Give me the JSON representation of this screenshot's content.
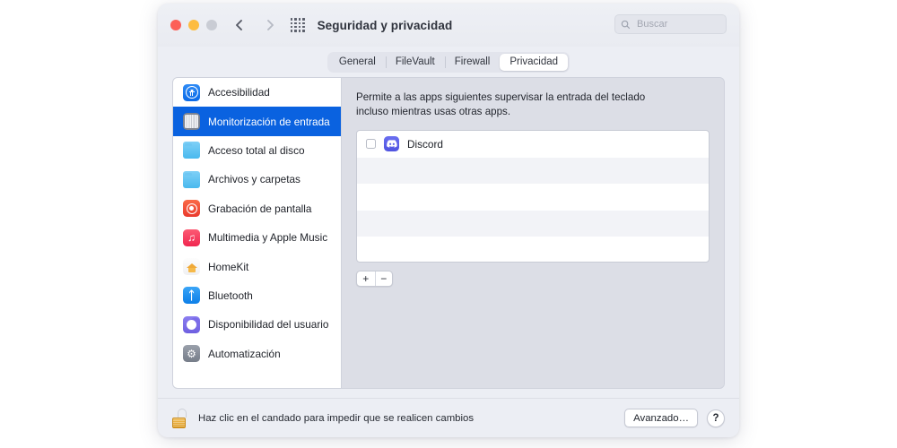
{
  "window": {
    "title": "Seguridad y privacidad",
    "traffic_lights": [
      "close",
      "minimize",
      "zoom"
    ],
    "nav": {
      "back_icon": "chevron-left-icon",
      "forward_icon": "chevron-right-icon",
      "grid_icon": "show-all-grid-icon"
    },
    "search": {
      "placeholder": "Buscar",
      "value": "",
      "icon": "search-icon"
    }
  },
  "tabs": [
    {
      "label": "General",
      "active": false
    },
    {
      "label": "FileVault",
      "active": false
    },
    {
      "label": "Firewall",
      "active": false
    },
    {
      "label": "Privacidad",
      "active": true
    }
  ],
  "sidebar": {
    "items": [
      {
        "label": "Accesibilidad",
        "icon": "accessibility-icon",
        "selected": false
      },
      {
        "label": "Monitorización de entrada",
        "icon": "keyboard-icon",
        "selected": true
      },
      {
        "label": "Acceso total al disco",
        "icon": "folder-icon",
        "selected": false
      },
      {
        "label": "Archivos y carpetas",
        "icon": "folder-icon",
        "selected": false
      },
      {
        "label": "Grabación de pantalla",
        "icon": "screen-record-icon",
        "selected": false
      },
      {
        "label": "Multimedia y Apple Music",
        "icon": "music-note-icon",
        "selected": false
      },
      {
        "label": "HomeKit",
        "icon": "home-icon",
        "selected": false
      },
      {
        "label": "Bluetooth",
        "icon": "bluetooth-icon",
        "selected": false
      },
      {
        "label": "Disponibilidad del usuario",
        "icon": "moon-icon",
        "selected": false
      },
      {
        "label": "Automatización",
        "icon": "gear-icon",
        "selected": false
      }
    ]
  },
  "content": {
    "description": "Permite a las apps siguientes supervisar la entrada del teclado incluso mientras usas otras apps.",
    "apps": [
      {
        "name": "Discord",
        "icon": "discord-icon",
        "checked": false
      }
    ],
    "add_label": "+",
    "remove_label": "−"
  },
  "footer": {
    "lock_icon": "padlock-open-icon",
    "lock_text": "Haz clic en el candado para impedir que se realicen cambios",
    "advanced_label": "Avanzado…",
    "help_label": "?"
  }
}
